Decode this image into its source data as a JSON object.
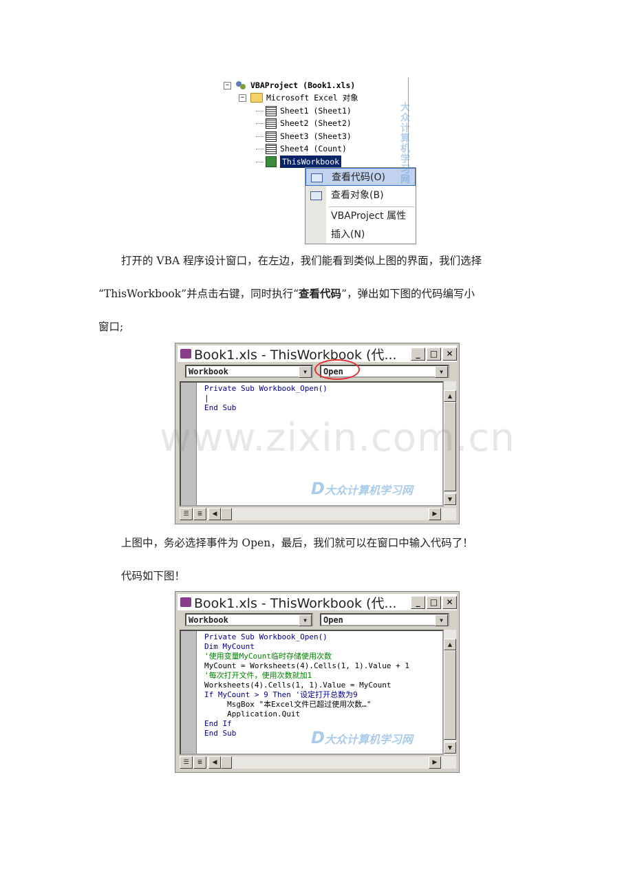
{
  "tree": {
    "project_label": "VBAProject (Book1.xls)",
    "folder_label": "Microsoft Excel 对象",
    "sheets": [
      "Sheet1 (Sheet1)",
      "Sheet2 (Sheet2)",
      "Sheet3 (Sheet3)",
      "Sheet4 (Count)"
    ],
    "workbook_label": "ThisWorkbook"
  },
  "context_menu": {
    "items": [
      "查看代码(O)",
      "查看对象(B)",
      "VBAProject 属性",
      "插入(N)"
    ]
  },
  "watermark": {
    "brand_cn": "大众计算机学习网",
    "site": "www.zixin.com.cn"
  },
  "paragraphs": {
    "p1": "打开的 VBA 程序设计窗口，在左边，我们能看到类似上图的界面，我们选择",
    "p2a": "“ThisWorkbook”并点击右键，同时执行“",
    "p2b": "查看代码",
    "p2c": "”，弹出如下图的代码编写小",
    "p3": "窗口;",
    "p4": "上图中，务必选择事件为 Open，最后，我们就可以在窗口中输入代码了！",
    "p5": "代码如下图！"
  },
  "window1": {
    "title": "Book1.xls - ThisWorkbook (代...",
    "object_combo": "Workbook",
    "proc_combo": "Open",
    "code": [
      "Private Sub Workbook_Open()",
      "|",
      "End Sub"
    ]
  },
  "window2": {
    "title": "Book1.xls - ThisWorkbook (代...",
    "object_combo": "Workbook",
    "proc_combo": "Open",
    "code": [
      "Private Sub Workbook_Open()",
      "Dim MyCount",
      "'使用变量MyCount临时存储使用次数",
      "MyCount = Worksheets(4).Cells(1, 1).Value + 1",
      "'每次打开文件，使用次数就加1",
      "Worksheets(4).Cells(1, 1).Value = MyCount",
      "If MyCount > 9 Then '设定打开总数为9",
      "     MsgBox \"本Excel文件已超过使用次数…\"",
      "     Application.Quit",
      "End If",
      "End Sub"
    ]
  },
  "colors": {
    "keyword": "#00008b",
    "comment": "#008000",
    "highlight": "#0a246a",
    "circle": "#e03030"
  }
}
